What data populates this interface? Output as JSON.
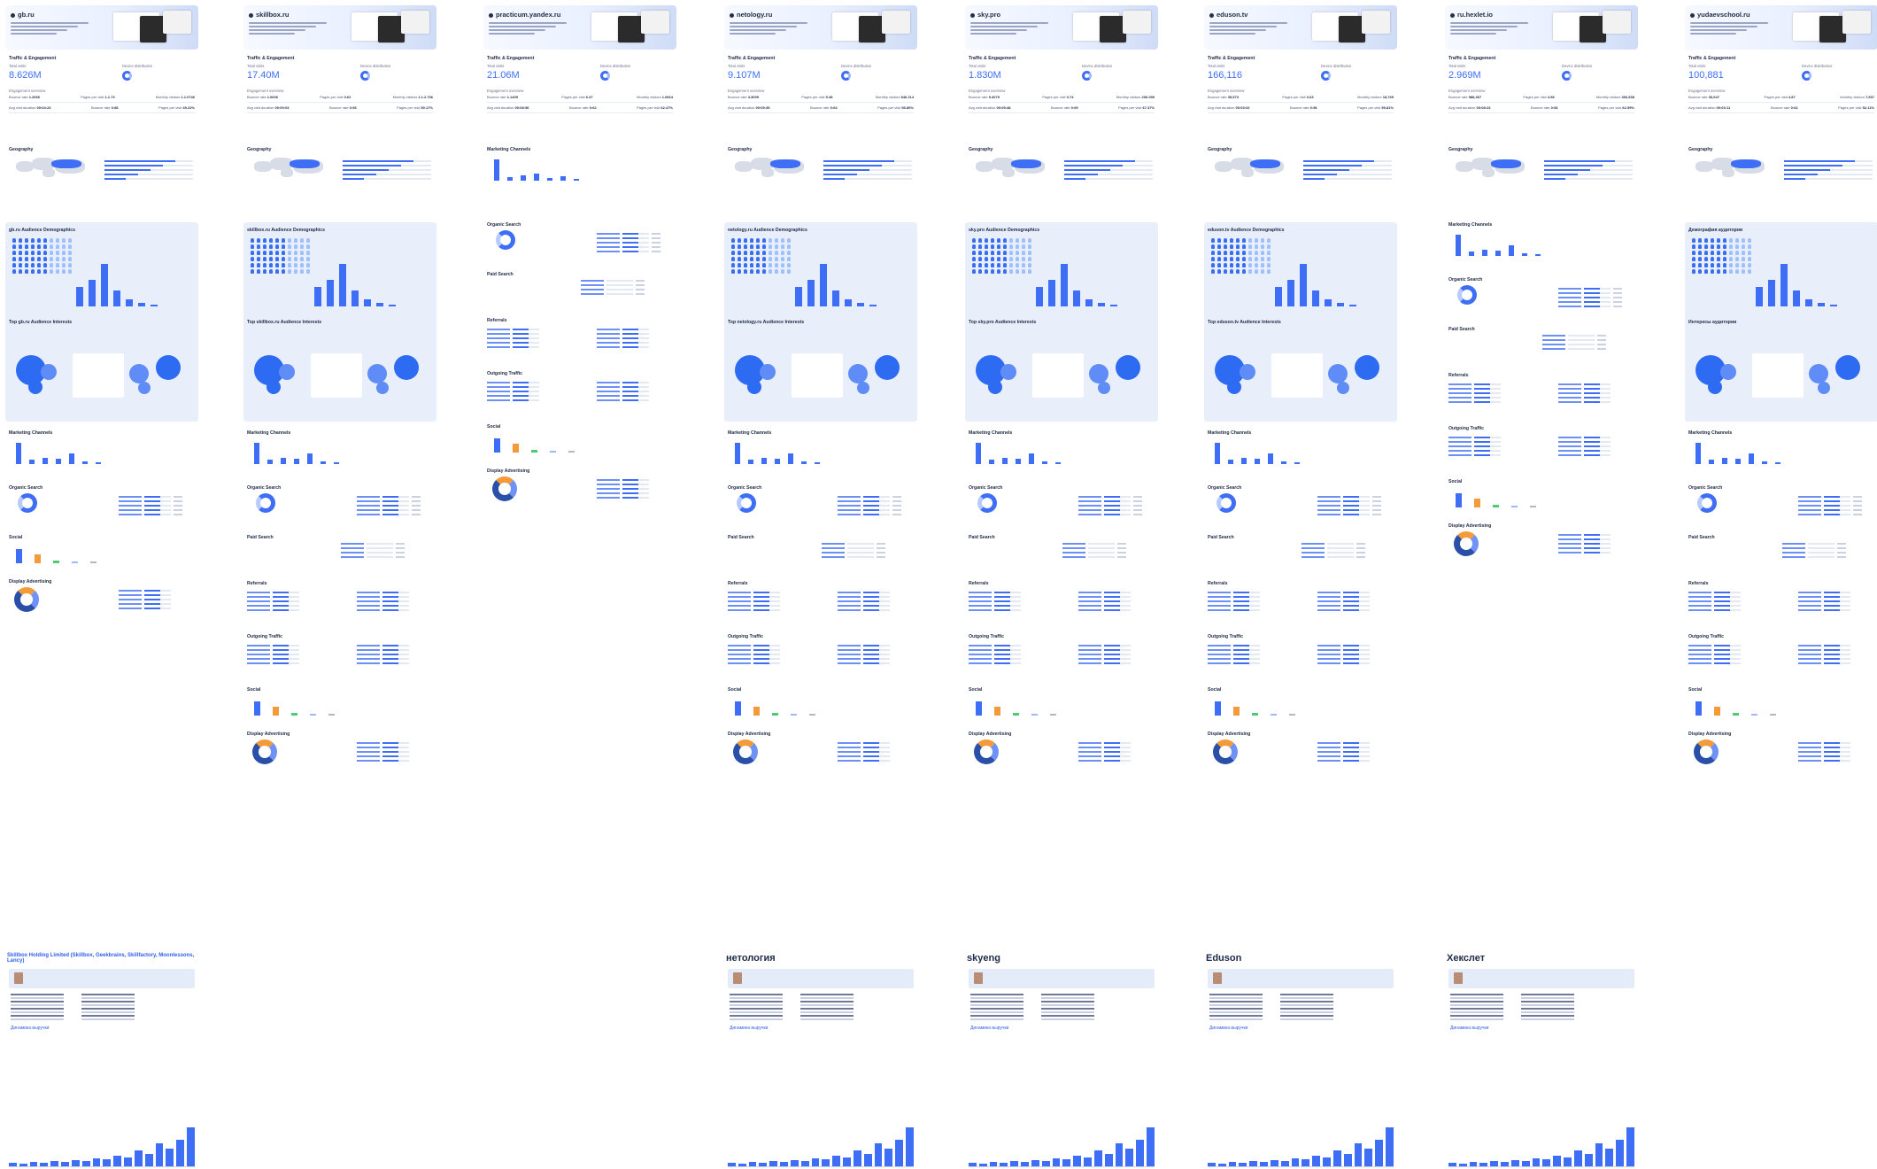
{
  "columns": [
    {
      "domain": "gb.ru",
      "total_visits": "8.626M",
      "lb_total": "Total visits",
      "lb_dev": "Device distribution",
      "lb_eng": "Engagement overview",
      "engagement": [
        [
          "Bounce rate",
          "1.2066"
        ],
        [
          "Pages per visit",
          "1.1.73"
        ],
        [
          "Monthly visitors",
          "1.1.0746"
        ],
        [
          "Avg visit duration",
          "00:04:23"
        ],
        [
          "Bounce rate",
          "0:86"
        ],
        [
          "Pages per visit",
          "49.22%"
        ]
      ],
      "sections": [
        "Traffic & Engagement",
        "Geography",
        "gb.ru Audience Demographics",
        "Top gb.ru Audience Interests",
        "Marketing Channels",
        "Organic Search",
        "Social",
        "Display Advertising"
      ],
      "company": {
        "title": "Skillbox Holding Limited (Skillbox, Geekbrains, Skillfactory, Moonlessons, Lancy)",
        "link": "Динамика выручки"
      }
    },
    {
      "domain": "skillbox.ru",
      "total_visits": "17.40M",
      "lb_total": "Total visits",
      "lb_dev": "Device distribution",
      "lb_eng": "Engagement overview",
      "engagement": [
        [
          "Bounce rate",
          "1.0606"
        ],
        [
          "Pages per visit",
          "0.62"
        ],
        [
          "Monthly visitors",
          "1.1.2.706"
        ],
        [
          "Avg visit duration",
          "00:09:03"
        ],
        [
          "Bounce rate",
          "0:93"
        ],
        [
          "Pages per visit",
          "50.17%"
        ]
      ],
      "sections": [
        "Traffic & Engagement",
        "Geography",
        "skillbox.ru Audience Demographics",
        "Top skillbox.ru Audience Interests",
        "Marketing Channels",
        "Organic Search",
        "Paid Search",
        "Referrals",
        "Outgoing Traffic",
        "Social",
        "Display Advertising"
      ],
      "company": null
    },
    {
      "domain": "practicum.yandex.ru",
      "total_visits": "21.06M",
      "lb_total": "Total visits",
      "lb_dev": "Device distribution",
      "lb_eng": "Engagement overview",
      "engagement": [
        [
          "Bounce rate",
          "1.1409"
        ],
        [
          "Pages per visit",
          "6.37"
        ],
        [
          "Monthly visitors",
          "1.0664"
        ],
        [
          "Avg visit duration",
          "00:08:56"
        ],
        [
          "Bounce rate",
          "0:62"
        ],
        [
          "Pages per visit",
          "62.47%"
        ]
      ],
      "sections": [
        "Traffic & Engagement",
        "Marketing Channels",
        "Organic Search",
        "Paid Search",
        "Referrals",
        "Outgoing Traffic",
        "Social",
        "Display Advertising"
      ],
      "company": null
    },
    {
      "domain": "netology.ru",
      "total_visits": "9.107M",
      "lb_total": "Total visits",
      "lb_dev": "Device distribution",
      "lb_eng": "Engagement overview",
      "engagement": [
        [
          "Bounce rate",
          "3.3099"
        ],
        [
          "Pages per visit",
          "5.38"
        ],
        [
          "Monthly visitors",
          "846.214"
        ],
        [
          "Avg visit duration",
          "00:09:35"
        ],
        [
          "Bounce rate",
          "0:64"
        ],
        [
          "Pages per visit",
          "56.86%"
        ]
      ],
      "sections": [
        "Traffic & Engagement",
        "Geography",
        "netology.ru Audience Demographics",
        "Top netology.ru Audience Interests",
        "Marketing Channels",
        "Organic Search",
        "Paid Search",
        "Referrals",
        "Outgoing Traffic",
        "Social",
        "Display Advertising"
      ],
      "company": {
        "title": "нетология",
        "link": "Динамика выручки"
      }
    },
    {
      "domain": "sky.pro",
      "total_visits": "1.830M",
      "lb_total": "Total visits",
      "lb_dev": "Device distribution",
      "lb_eng": "Engagement overview",
      "engagement": [
        [
          "Bounce rate",
          "9.4079"
        ],
        [
          "Pages per visit",
          "0.74"
        ],
        [
          "Monthly visitors",
          "206.099"
        ],
        [
          "Avg visit duration",
          "00:05:48"
        ],
        [
          "Bounce rate",
          "0:69"
        ],
        [
          "Pages per visit",
          "67.37%"
        ]
      ],
      "sections": [
        "Traffic & Engagement",
        "Geography",
        "sky.pro Audience Demographics",
        "Top sky.pro Audience Interests",
        "Marketing Channels",
        "Organic Search",
        "Paid Search",
        "Referrals",
        "Outgoing Traffic",
        "Social",
        "Display Advertising"
      ],
      "company": {
        "title": "skyeng",
        "link": "Динамика выручки"
      }
    },
    {
      "domain": "eduson.tv",
      "total_visits": "166,116",
      "lb_total": "Total visits",
      "lb_dev": "Device distribution",
      "lb_eng": "Engagement overview",
      "engagement": [
        [
          "Bounce rate",
          "35,573"
        ],
        [
          "Pages per visit",
          "3.63"
        ],
        [
          "Monthly visitors",
          "18,769"
        ],
        [
          "Avg visit duration",
          "00:03:02"
        ],
        [
          "Bounce rate",
          "0:56"
        ],
        [
          "Pages per visit",
          "59.81%"
        ]
      ],
      "sections": [
        "Traffic & Engagement",
        "Geography",
        "eduson.tv Audience Demographics",
        "Top eduson.tv Audience Interests",
        "Marketing Channels",
        "Organic Search",
        "Paid Search",
        "Referrals",
        "Outgoing Traffic",
        "Social",
        "Display Advertising"
      ],
      "company": {
        "title": "Eduson",
        "link": "Динамика выручки"
      }
    },
    {
      "domain": "ru.hexlet.io",
      "total_visits": "2.969M",
      "lb_total": "Total visits",
      "lb_dev": "Device distribution",
      "lb_eng": "Engagement overview",
      "engagement": [
        [
          "Bounce rate",
          "988,367"
        ],
        [
          "Pages per visit",
          "4.98"
        ],
        [
          "Monthly visitors",
          "306,538"
        ],
        [
          "Avg visit duration",
          "00:08:23"
        ],
        [
          "Bounce rate",
          "0:66"
        ],
        [
          "Pages per visit",
          "62.59%"
        ]
      ],
      "sections": [
        "Traffic & Engagement",
        "Geography",
        "Marketing Channels",
        "Organic Search",
        "Paid Search",
        "Referrals",
        "Outgoing Traffic",
        "Social",
        "Display Advertising"
      ],
      "company": {
        "title": "Хекслет",
        "link": "Динамика выручки"
      }
    },
    {
      "domain": "yudaevschool.ru",
      "total_visits": "100,881",
      "lb_total": "Total visits",
      "lb_dev": "Device distribution",
      "lb_eng": "Engagement overview",
      "engagement": [
        [
          "Bounce rate",
          "30,647"
        ],
        [
          "Pages per visit",
          "4.87"
        ],
        [
          "Monthly visitors",
          "7,937"
        ],
        [
          "Avg visit duration",
          "00:03:11"
        ],
        [
          "Bounce rate",
          "0:62"
        ],
        [
          "Pages per visit",
          "52.11%"
        ]
      ],
      "sections": [
        "Traffic & Engagement",
        "Geography",
        "Демография аудитории",
        "Интересы аудитории",
        "Marketing Channels",
        "Organic Search",
        "Paid Search",
        "Referrals",
        "Outgoing Traffic",
        "Social",
        "Display Advertising"
      ],
      "company": null
    }
  ],
  "colors": {
    "accent": "#3d6ef5",
    "dark": "#1e2a46",
    "light_panel": "#e9eefb",
    "orange": "#f39b3a"
  }
}
